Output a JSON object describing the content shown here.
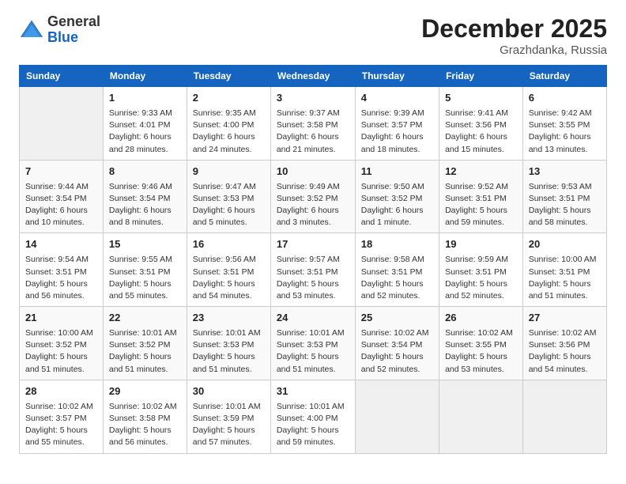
{
  "header": {
    "logo": {
      "general": "General",
      "blue": "Blue"
    },
    "month": "December 2025",
    "location": "Grazhdanka, Russia"
  },
  "days_of_week": [
    "Sunday",
    "Monday",
    "Tuesday",
    "Wednesday",
    "Thursday",
    "Friday",
    "Saturday"
  ],
  "weeks": [
    [
      {
        "num": "",
        "info": ""
      },
      {
        "num": "1",
        "info": "Sunrise: 9:33 AM\nSunset: 4:01 PM\nDaylight: 6 hours\nand 28 minutes."
      },
      {
        "num": "2",
        "info": "Sunrise: 9:35 AM\nSunset: 4:00 PM\nDaylight: 6 hours\nand 24 minutes."
      },
      {
        "num": "3",
        "info": "Sunrise: 9:37 AM\nSunset: 3:58 PM\nDaylight: 6 hours\nand 21 minutes."
      },
      {
        "num": "4",
        "info": "Sunrise: 9:39 AM\nSunset: 3:57 PM\nDaylight: 6 hours\nand 18 minutes."
      },
      {
        "num": "5",
        "info": "Sunrise: 9:41 AM\nSunset: 3:56 PM\nDaylight: 6 hours\nand 15 minutes."
      },
      {
        "num": "6",
        "info": "Sunrise: 9:42 AM\nSunset: 3:55 PM\nDaylight: 6 hours\nand 13 minutes."
      }
    ],
    [
      {
        "num": "7",
        "info": "Sunrise: 9:44 AM\nSunset: 3:54 PM\nDaylight: 6 hours\nand 10 minutes."
      },
      {
        "num": "8",
        "info": "Sunrise: 9:46 AM\nSunset: 3:54 PM\nDaylight: 6 hours\nand 8 minutes."
      },
      {
        "num": "9",
        "info": "Sunrise: 9:47 AM\nSunset: 3:53 PM\nDaylight: 6 hours\nand 5 minutes."
      },
      {
        "num": "10",
        "info": "Sunrise: 9:49 AM\nSunset: 3:52 PM\nDaylight: 6 hours\nand 3 minutes."
      },
      {
        "num": "11",
        "info": "Sunrise: 9:50 AM\nSunset: 3:52 PM\nDaylight: 6 hours\nand 1 minute."
      },
      {
        "num": "12",
        "info": "Sunrise: 9:52 AM\nSunset: 3:51 PM\nDaylight: 5 hours\nand 59 minutes."
      },
      {
        "num": "13",
        "info": "Sunrise: 9:53 AM\nSunset: 3:51 PM\nDaylight: 5 hours\nand 58 minutes."
      }
    ],
    [
      {
        "num": "14",
        "info": "Sunrise: 9:54 AM\nSunset: 3:51 PM\nDaylight: 5 hours\nand 56 minutes."
      },
      {
        "num": "15",
        "info": "Sunrise: 9:55 AM\nSunset: 3:51 PM\nDaylight: 5 hours\nand 55 minutes."
      },
      {
        "num": "16",
        "info": "Sunrise: 9:56 AM\nSunset: 3:51 PM\nDaylight: 5 hours\nand 54 minutes."
      },
      {
        "num": "17",
        "info": "Sunrise: 9:57 AM\nSunset: 3:51 PM\nDaylight: 5 hours\nand 53 minutes."
      },
      {
        "num": "18",
        "info": "Sunrise: 9:58 AM\nSunset: 3:51 PM\nDaylight: 5 hours\nand 52 minutes."
      },
      {
        "num": "19",
        "info": "Sunrise: 9:59 AM\nSunset: 3:51 PM\nDaylight: 5 hours\nand 52 minutes."
      },
      {
        "num": "20",
        "info": "Sunrise: 10:00 AM\nSunset: 3:51 PM\nDaylight: 5 hours\nand 51 minutes."
      }
    ],
    [
      {
        "num": "21",
        "info": "Sunrise: 10:00 AM\nSunset: 3:52 PM\nDaylight: 5 hours\nand 51 minutes."
      },
      {
        "num": "22",
        "info": "Sunrise: 10:01 AM\nSunset: 3:52 PM\nDaylight: 5 hours\nand 51 minutes."
      },
      {
        "num": "23",
        "info": "Sunrise: 10:01 AM\nSunset: 3:53 PM\nDaylight: 5 hours\nand 51 minutes."
      },
      {
        "num": "24",
        "info": "Sunrise: 10:01 AM\nSunset: 3:53 PM\nDaylight: 5 hours\nand 51 minutes."
      },
      {
        "num": "25",
        "info": "Sunrise: 10:02 AM\nSunset: 3:54 PM\nDaylight: 5 hours\nand 52 minutes."
      },
      {
        "num": "26",
        "info": "Sunrise: 10:02 AM\nSunset: 3:55 PM\nDaylight: 5 hours\nand 53 minutes."
      },
      {
        "num": "27",
        "info": "Sunrise: 10:02 AM\nSunset: 3:56 PM\nDaylight: 5 hours\nand 54 minutes."
      }
    ],
    [
      {
        "num": "28",
        "info": "Sunrise: 10:02 AM\nSunset: 3:57 PM\nDaylight: 5 hours\nand 55 minutes."
      },
      {
        "num": "29",
        "info": "Sunrise: 10:02 AM\nSunset: 3:58 PM\nDaylight: 5 hours\nand 56 minutes."
      },
      {
        "num": "30",
        "info": "Sunrise: 10:01 AM\nSunset: 3:59 PM\nDaylight: 5 hours\nand 57 minutes."
      },
      {
        "num": "31",
        "info": "Sunrise: 10:01 AM\nSunset: 4:00 PM\nDaylight: 5 hours\nand 59 minutes."
      },
      {
        "num": "",
        "info": ""
      },
      {
        "num": "",
        "info": ""
      },
      {
        "num": "",
        "info": ""
      }
    ]
  ]
}
